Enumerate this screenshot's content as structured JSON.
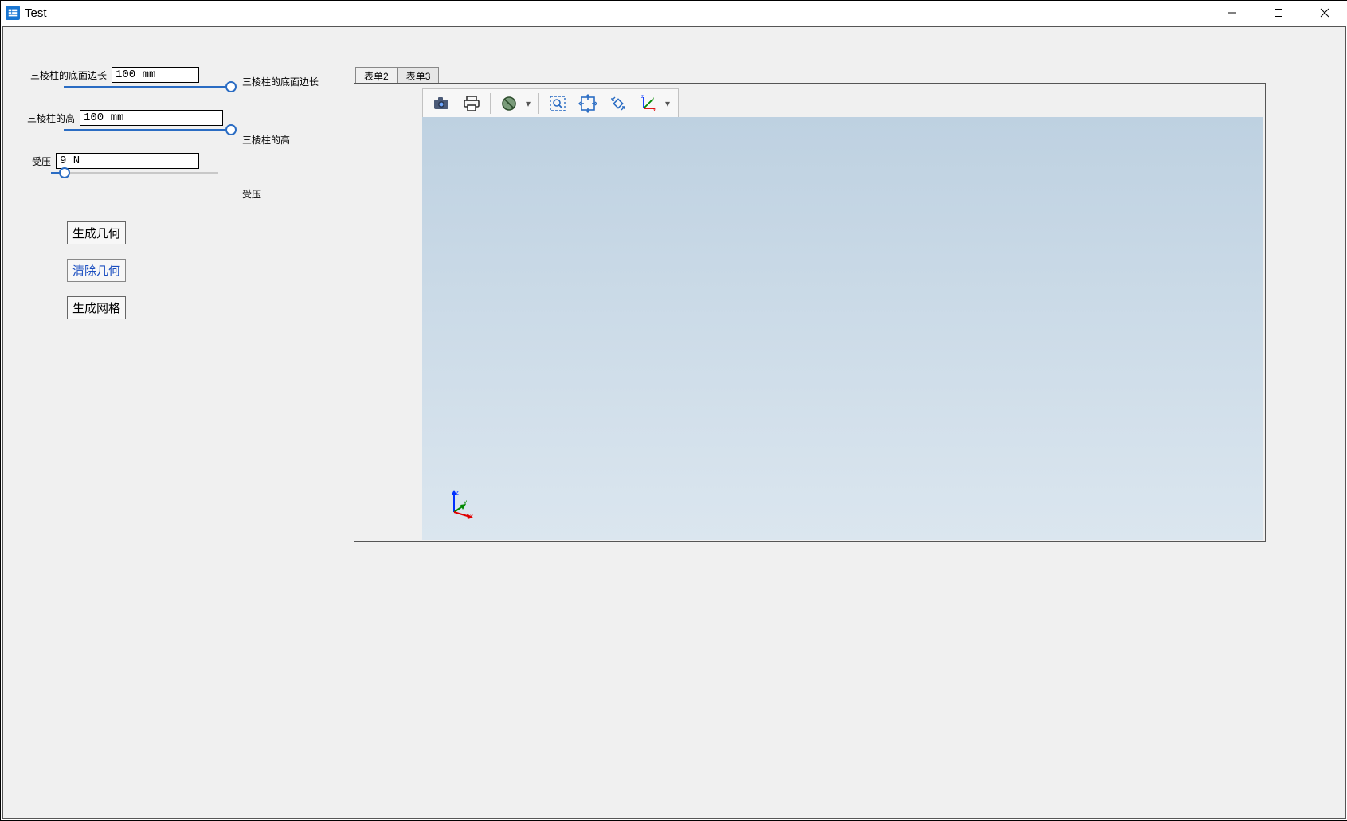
{
  "window": {
    "title": "Test"
  },
  "params": {
    "edge": {
      "label": "三棱柱的底面边长",
      "value": "100 mm",
      "slider_pct": 100
    },
    "height": {
      "label": "三棱柱的高",
      "value": "100 mm",
      "slider_pct": 100
    },
    "press": {
      "label": "受压",
      "value": "9 N",
      "slider_pct": 8
    }
  },
  "side_labels": {
    "edge": "三棱柱的底面边长",
    "height": "三棱柱的高",
    "press": "受压"
  },
  "buttons": {
    "gen_geom": "生成几何",
    "clear_geom": "清除几何",
    "gen_mesh": "生成网格"
  },
  "tabs": {
    "t2": "表单2",
    "t3": "表单3",
    "active": "t2"
  },
  "toolbar": {
    "snapshot_icon": "camera-icon",
    "print_icon": "printer-icon",
    "hide_icon": "no-entry-icon",
    "zoom_box_icon": "zoom-box-icon",
    "zoom_extent_icon": "zoom-extents-icon",
    "rotate_icon": "rotate-icon",
    "axes_icon": "axes-icon"
  },
  "axis_labels": {
    "x": "x",
    "y": "y",
    "z": "z"
  }
}
